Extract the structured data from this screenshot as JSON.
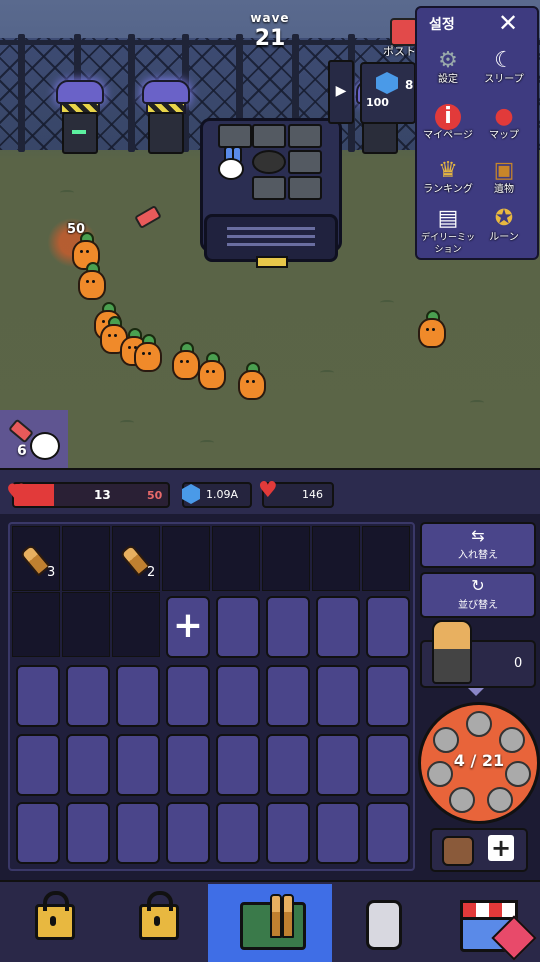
{
  "hud": {
    "wave_label": "wave",
    "wave_number": "21"
  },
  "field": {
    "damage_popup": "50",
    "player_count": "6",
    "post_label": "ポスト",
    "gem_box_value": "100",
    "gem_side_value": "8"
  },
  "settings_menu": {
    "title": "설정",
    "close_glyph": "✕",
    "items": [
      {
        "label": "設定",
        "icon": "gear-icon"
      },
      {
        "label": "スリープ",
        "icon": "sleep-bunny-icon"
      },
      {
        "label": "マイページ",
        "icon": "info-icon"
      },
      {
        "label": "マップ",
        "icon": "map-pin-icon"
      },
      {
        "label": "ランキング",
        "icon": "trophy-icon"
      },
      {
        "label": "遺物",
        "icon": "chest-icon"
      },
      {
        "label": "デイリーミッション",
        "icon": "calendar-icon"
      },
      {
        "label": "ルーン",
        "icon": "rune-medal-icon"
      }
    ]
  },
  "status": {
    "hp_current": "13",
    "hp_max": "50",
    "hp_fraction": 0.26,
    "gems": "1.09A",
    "hearts": "146"
  },
  "inventory": {
    "bullets": [
      {
        "count": "3"
      },
      {
        "count": "2"
      }
    ],
    "add_glyph": "+",
    "swap_label": "入れ替え",
    "sort_label": "並び替え",
    "ammo_count": "0",
    "revolver_text": "4 / 21",
    "bag_plus": "+"
  },
  "tabs": [
    {
      "name": "locked-1",
      "icon": "lock-icon"
    },
    {
      "name": "locked-2",
      "icon": "lock-icon"
    },
    {
      "name": "bullets",
      "icon": "ammo-crate-icon"
    },
    {
      "name": "dog-tags",
      "icon": "dogtag-icon"
    },
    {
      "name": "shop",
      "icon": "shop-icon"
    }
  ],
  "colors": {
    "hp_red": "#e23a3a",
    "panel": "#4a458a",
    "tab_active": "#3f6ee6",
    "menu_bg": "#3e3b80",
    "revolver": "#e8643a"
  }
}
